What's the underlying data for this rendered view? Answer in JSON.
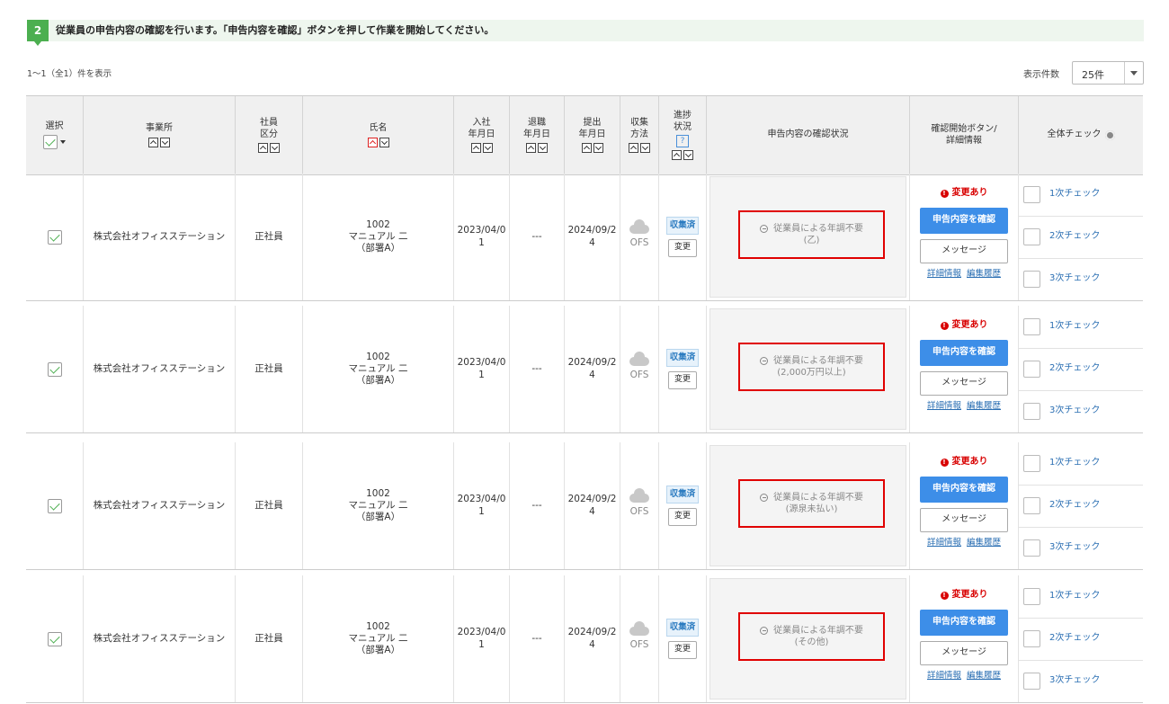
{
  "step": {
    "number": "2",
    "text": "従業員の申告内容の確認を行います。「申告内容を確認」ボタンを押して作業を開始してください。"
  },
  "result_count": "1～1（全1）件を表示",
  "per_page": {
    "label": "表示件数",
    "value": "25件"
  },
  "headers": {
    "select": "選択",
    "office": "事業所",
    "employee_type": "社員\n区分",
    "name": "氏名",
    "hire_date": "入社\n年月日",
    "retire_date": "退職\n年月日",
    "submit_date": "提出\n年月日",
    "collect_method": "収集\n方法",
    "progress": "進捗\n状況",
    "progress_help": "?",
    "review_status": "申告内容の確認状況",
    "start_button_detail": "確認開始ボタン/\n詳細情報",
    "all_check": "全体チェック"
  },
  "rows": [
    {
      "office": "株式会社オフィスステーション",
      "employee_type": "正社員",
      "emp_no": "1002",
      "name": "マニュアル 二",
      "dept": "（部署A）",
      "hire_date": "2023/04/0\n1",
      "retire_date": "---",
      "submit_date": "2024/09/2\n4",
      "collect_method": "OFS",
      "progress_tag": "収集済",
      "change_button": "変更",
      "status_line1": "従業員による年調不要",
      "status_line2": "(乙)",
      "changed_label": "変更あり",
      "confirm_button": "申告内容を確認",
      "message_button": "メッセージ",
      "detail_link": "詳細情報",
      "history_link": "編集履歴",
      "checks": [
        "1次チェック",
        "2次チェック",
        "3次チェック"
      ]
    },
    {
      "office": "株式会社オフィスステーション",
      "employee_type": "正社員",
      "emp_no": "1002",
      "name": "マニュアル 二",
      "dept": "（部署A）",
      "hire_date": "2023/04/0\n1",
      "retire_date": "---",
      "submit_date": "2024/09/2\n4",
      "collect_method": "OFS",
      "progress_tag": "収集済",
      "change_button": "変更",
      "status_line1": "従業員による年調不要",
      "status_line2": "(2,000万円以上)",
      "changed_label": "変更あり",
      "confirm_button": "申告内容を確認",
      "message_button": "メッセージ",
      "detail_link": "詳細情報",
      "history_link": "編集履歴",
      "checks": [
        "1次チェック",
        "2次チェック",
        "3次チェック"
      ]
    },
    {
      "office": "株式会社オフィスステーション",
      "employee_type": "正社員",
      "emp_no": "1002",
      "name": "マニュアル 二",
      "dept": "（部署A）",
      "hire_date": "2023/04/0\n1",
      "retire_date": "---",
      "submit_date": "2024/09/2\n4",
      "collect_method": "OFS",
      "progress_tag": "収集済",
      "change_button": "変更",
      "status_line1": "従業員による年調不要",
      "status_line2": "(源泉未払い)",
      "changed_label": "変更あり",
      "confirm_button": "申告内容を確認",
      "message_button": "メッセージ",
      "detail_link": "詳細情報",
      "history_link": "編集履歴",
      "checks": [
        "1次チェック",
        "2次チェック",
        "3次チェック"
      ]
    },
    {
      "office": "株式会社オフィスステーション",
      "employee_type": "正社員",
      "emp_no": "1002",
      "name": "マニュアル 二",
      "dept": "（部署A）",
      "hire_date": "2023/04/0\n1",
      "retire_date": "---",
      "submit_date": "2024/09/2\n4",
      "collect_method": "OFS",
      "progress_tag": "収集済",
      "change_button": "変更",
      "status_line1": "従業員による年調不要",
      "status_line2": "(その他)",
      "changed_label": "変更あり",
      "confirm_button": "申告内容を確認",
      "message_button": "メッセージ",
      "detail_link": "詳細情報",
      "history_link": "編集履歴",
      "checks": [
        "1次チェック",
        "2次チェック",
        "3次チェック"
      ]
    }
  ]
}
